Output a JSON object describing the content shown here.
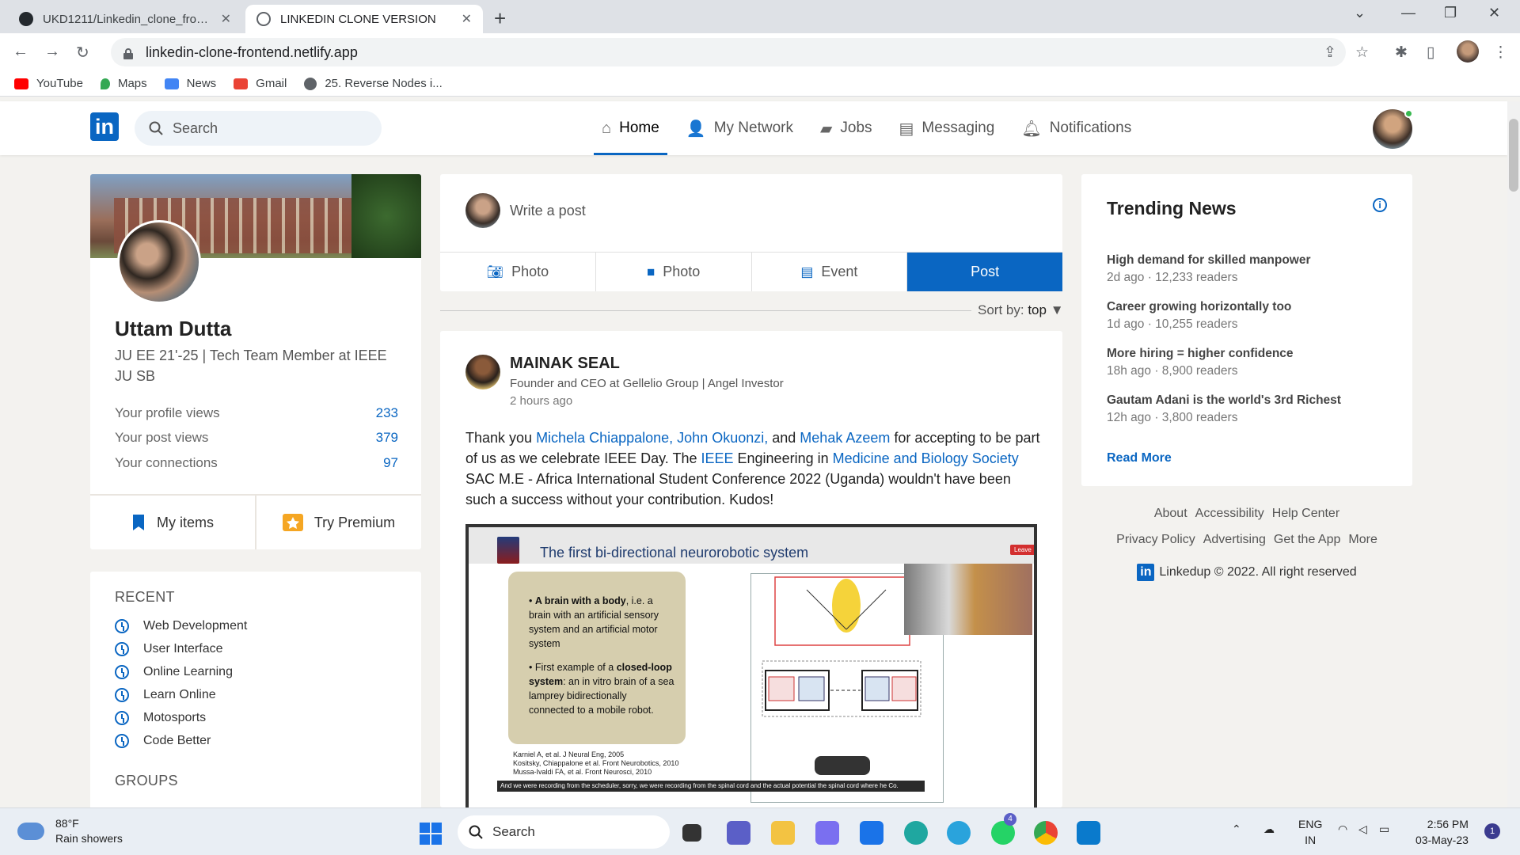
{
  "browser": {
    "tabs": [
      {
        "title": "UKD1211/Linkedin_clone_fronten",
        "close": "✕"
      },
      {
        "title": "LINKEDIN CLONE VERSION",
        "close": "✕"
      }
    ],
    "new_tab": "+",
    "url": "linkedin-clone-frontend.netlify.app",
    "bookmarks": [
      {
        "label": "YouTube",
        "color": "#ff0000"
      },
      {
        "label": "Maps",
        "color": "#34a853"
      },
      {
        "label": "News",
        "color": "#4285f4"
      },
      {
        "label": "Gmail",
        "color": "#ea4335"
      },
      {
        "label": "25. Reverse Nodes i...",
        "color": "#5f6368"
      }
    ]
  },
  "header": {
    "logo": "in",
    "search_placeholder": "Search",
    "nav": [
      {
        "label": "Home",
        "icon": "home-icon",
        "active": true
      },
      {
        "label": "My Network",
        "icon": "network-icon"
      },
      {
        "label": "Jobs",
        "icon": "briefcase-icon"
      },
      {
        "label": "Messaging",
        "icon": "chat-icon"
      },
      {
        "label": "Notifications",
        "icon": "bell-icon"
      }
    ]
  },
  "profile": {
    "name": "Uttam Dutta",
    "headline": "JU EE 21'-25 | Tech Team Member at IEEE JU SB",
    "stats": [
      {
        "label": "Your profile views",
        "value": "233"
      },
      {
        "label": "Your post views",
        "value": "379"
      },
      {
        "label": "Your connections",
        "value": "97"
      }
    ],
    "my_items": "My items",
    "try_premium": "Try Premium"
  },
  "recent": {
    "title": "RECENT",
    "items": [
      "Web Development",
      "User Interface",
      "Online Learning",
      "Learn Online",
      "Motosports",
      "Code Better"
    ],
    "groups_title": "GROUPS"
  },
  "share": {
    "placeholder": "Write a post",
    "tabs": [
      "Photo",
      "Photo",
      "Event",
      "Post"
    ]
  },
  "sort": {
    "label": "Sort by:",
    "value": "top"
  },
  "post": {
    "author": "MAINAK SEAL",
    "author_title": "Founder and CEO at Gellelio Group | Angel Investor",
    "time": "2 hours ago",
    "text": {
      "t1": "Thank you ",
      "l1": "Michela Chiappalone, John Okuonzi,",
      "t2": " and ",
      "l2": "Mehak Azeem",
      "t3": " for accepting to be part of us as we celebrate IEEE Day. The ",
      "l3": "IEEE",
      "t4": " Engineering in ",
      "l4": "Medicine and Biology Society",
      "t5": " SAC M.E - Africa International Student Conference 2022 (Uganda) wouldn't have been such a success without your contribution. Kudos!"
    },
    "image": {
      "slide_title": "The first bi-directional neurorobotic system",
      "leave": "Leave",
      "bullet1_bold": "A brain with a body",
      "bullet1_rest": ", i.e. a brain with an artificial sensory system and an artificial motor system",
      "bullet2_pre": "First example of a ",
      "bullet2_bold": "closed-loop system",
      "bullet2_rest": ": an in vitro brain of a sea lamprey bidirectionally connected to a mobile robot.",
      "refs": [
        "Karniel A, et al. J Neural Eng, 2005",
        "Kositsky, Chiappalone et al. Front Neurobotics, 2010",
        "Mussa-Ivaldi FA, et al. Front Neurosci, 2010"
      ],
      "caption": "And we were recording from the scheduler, sorry, we were recording from the spinal cord and the actual potential the spinal cord where he Co."
    }
  },
  "news": {
    "title": "Trending News",
    "items": [
      {
        "headline": "High demand for skilled manpower",
        "meta": "2d ago · 12,233 readers"
      },
      {
        "headline": "Career growing horizontally too",
        "meta": "1d ago · 10,255 readers"
      },
      {
        "headline": "More hiring = higher confidence",
        "meta": "18h ago · 8,900 readers"
      },
      {
        "headline": "Gautam Adani is the world's 3rd Richest",
        "meta": "12h ago · 3,800 readers"
      }
    ],
    "read_more": "Read More"
  },
  "footer": {
    "row1": [
      "About",
      "Accessibility",
      "Help Center"
    ],
    "row2": [
      "Privacy Policy",
      "Advertising",
      "Get the App",
      "More"
    ],
    "brand": "Linkedup © 2022. All right reserved"
  },
  "taskbar": {
    "temp": "88°F",
    "weather": "Rain showers",
    "search": "Search",
    "lang1": "ENG",
    "lang2": "IN",
    "time": "2:56 PM",
    "date": "03-May-23",
    "whatsapp_badge": "4",
    "notif_count": "1"
  },
  "colors": {
    "brand": "#0a66c2",
    "page_bg": "#f3f2ef"
  }
}
